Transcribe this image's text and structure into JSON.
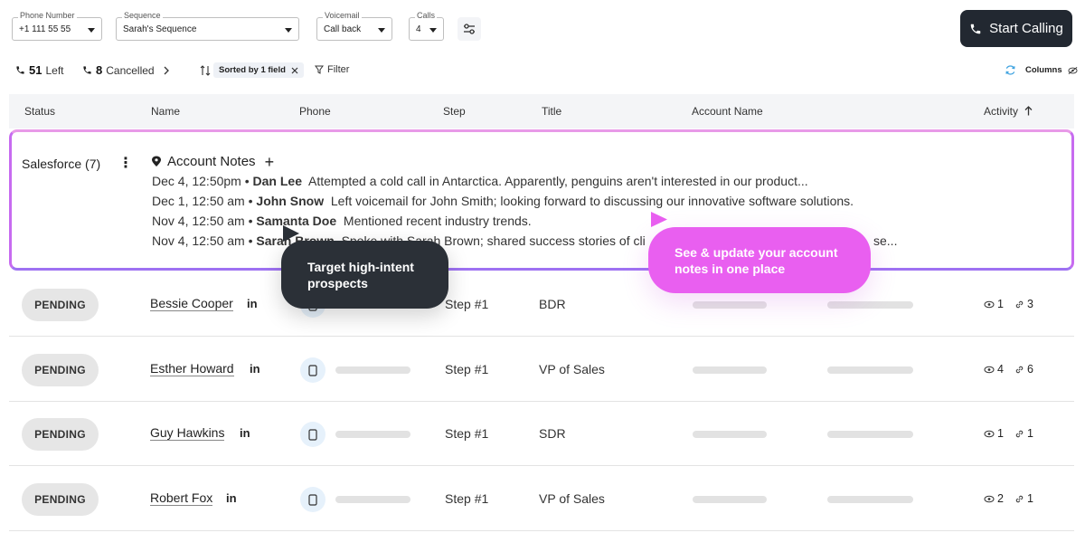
{
  "toolbar": {
    "phone_number": {
      "label": "Phone Number",
      "value": "+1 111 55 55"
    },
    "sequence": {
      "label": "Sequence",
      "value": "Sarah's Sequence"
    },
    "voicemail": {
      "label": "Voicemail",
      "value": "Call back"
    },
    "calls": {
      "label": "Calls",
      "value": "4"
    },
    "start_calling_label": "Start Calling"
  },
  "status_bar": {
    "left_count": "51",
    "left_label": "Left",
    "cancelled_count": "8",
    "cancelled_label": "Cancelled",
    "sorted_label": "Sorted by 1 field",
    "filter_label": "Filter",
    "columns_label": "Columns"
  },
  "table": {
    "columns": [
      "Status",
      "Name",
      "Phone",
      "Step",
      "Title",
      "Account Name",
      "Activity"
    ]
  },
  "account_group": {
    "label": "Salesforce (7)",
    "notes_title": "Account Notes",
    "notes": [
      {
        "date": "Dec 4, 12:50pm",
        "author": "Dan Lee",
        "text": "Attempted a cold call in Antarctica. Apparently, penguins aren't interested in our product..."
      },
      {
        "date": "Dec 1, 12:50 am",
        "author": "John Snow",
        "text": "Left voicemail for John Smith; looking forward to discussing our innovative software solutions."
      },
      {
        "date": "Nov 4, 12:50 am",
        "author": "Samanta Doe",
        "text": "Mentioned recent industry trends."
      },
      {
        "date": "Nov 4, 12:50 am",
        "author": "Sarah Brown",
        "text": "Spoke with Sarah Brown; shared success stories of cli"
      },
      {
        "tail": "se..."
      }
    ]
  },
  "rows": [
    {
      "status": "PENDING",
      "name": "Bessie Cooper",
      "linkedin": "in",
      "step": "Step #1",
      "title": "BDR",
      "views": "1",
      "links": "3"
    },
    {
      "status": "PENDING",
      "name": "Esther Howard",
      "linkedin": "in",
      "step": "Step #1",
      "title": "VP of Sales",
      "views": "4",
      "links": "6"
    },
    {
      "status": "PENDING",
      "name": "Guy Hawkins",
      "linkedin": "in",
      "step": "Step #1",
      "title": "SDR",
      "views": "1",
      "links": "1"
    },
    {
      "status": "PENDING",
      "name": "Robert Fox",
      "linkedin": "in",
      "step": "Step #1",
      "title": "VP of Sales",
      "views": "2",
      "links": "1"
    }
  ],
  "tooltips": {
    "dark": "Target high-intent prospects",
    "pink": "See & update your account notes in one place"
  },
  "colors": {
    "start_button": "#222831",
    "notes_border": "#c76bf0",
    "tooltip_dark": "#2b3037",
    "tooltip_pink": "#e95ff0",
    "phone_icon_bg": "#e6f1fb"
  }
}
